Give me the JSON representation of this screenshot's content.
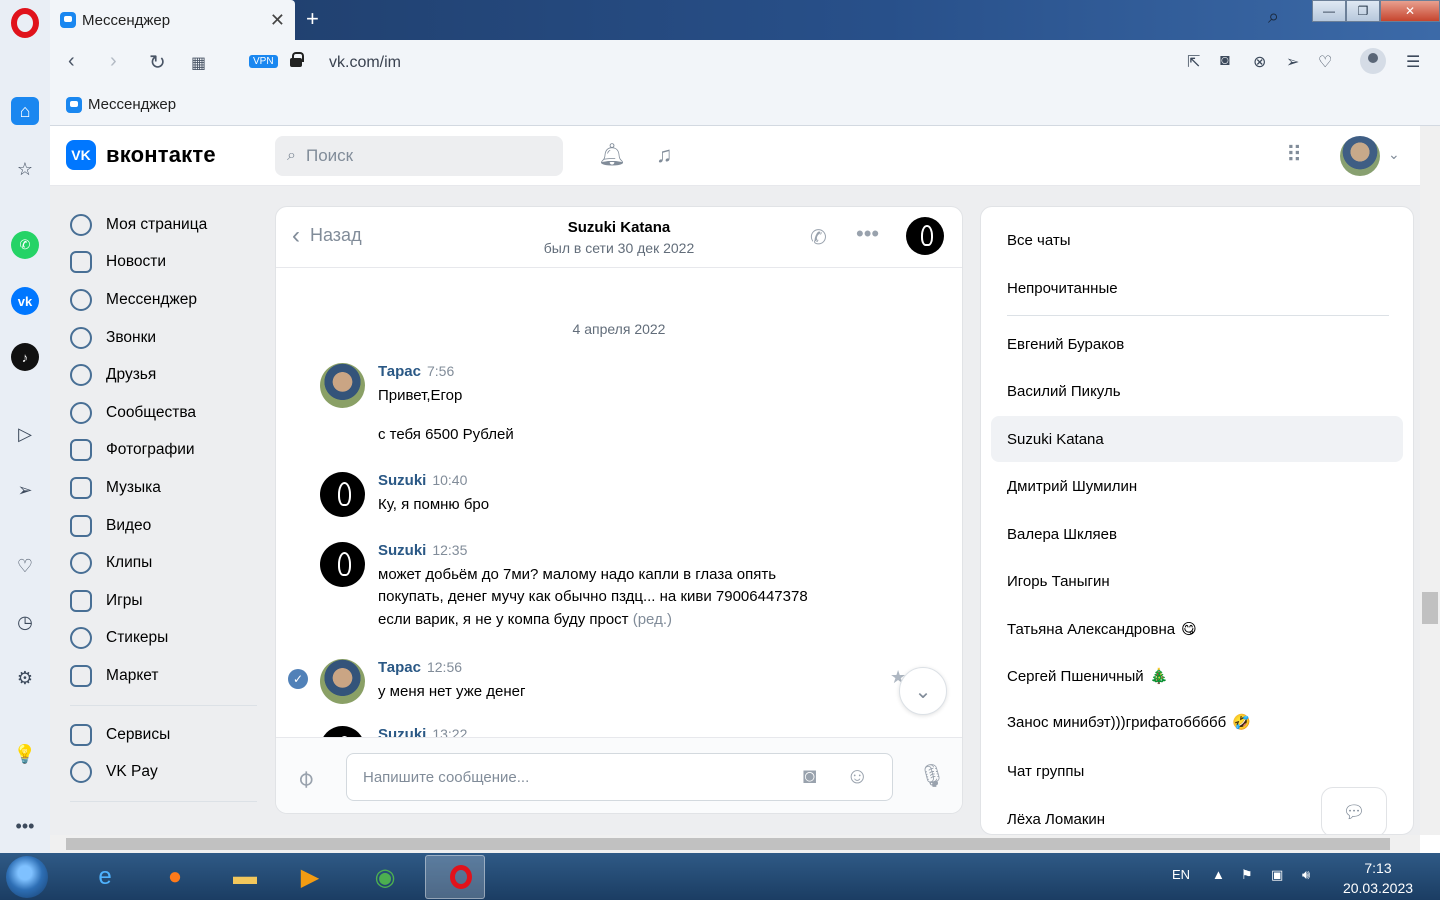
{
  "browser": {
    "tab_title": "Мессенджер",
    "tab_close": "✕",
    "new_tab": "+",
    "vpn": "VPN",
    "url": "vk.com/im",
    "bookmark": "Мессенджер"
  },
  "vk": {
    "logo_short": "VK",
    "logo_text": "вконтакте",
    "search_placeholder": "Поиск"
  },
  "nav": {
    "items": [
      "Моя страница",
      "Новости",
      "Мессенджер",
      "Звонки",
      "Друзья",
      "Сообщества",
      "Фотографии",
      "Музыка",
      "Видео",
      "Клипы",
      "Игры",
      "Стикеры",
      "Маркет"
    ],
    "items2": [
      "Сервисы",
      "VK Pay"
    ]
  },
  "chat": {
    "back": "Назад",
    "peer_name": "Suzuki Katana",
    "peer_status": "был в сети 30 дек 2022",
    "date": "4 апреля 2022",
    "messages": [
      {
        "author": "Тарас",
        "time": "7:56",
        "lines": [
          "Привет,Егор"
        ]
      },
      {
        "text": "с тебя 6500 Рублей"
      },
      {
        "author": "Suzuki",
        "time": "10:40",
        "lines": [
          "Ку, я помню бро"
        ]
      },
      {
        "author": "Suzuki",
        "time": "12:35",
        "lines": [
          "может добьём до 7ми? малому надо капли в глаза опять",
          "покупать, денег мучу как обычно пздц... на киви 79006447378",
          "если варик, я не у компа буду прост"
        ],
        "edited": "(ред.)"
      },
      {
        "author": "Тарас",
        "time": "12:56",
        "lines": [
          "у меня нет уже денег"
        ]
      },
      {
        "author": "Suzuki",
        "time": "13:22"
      }
    ],
    "composer_placeholder": "Напишите сообщение..."
  },
  "chat_list": {
    "filters": [
      "Все чаты",
      "Непрочитанные"
    ],
    "chats": [
      {
        "name": "Евгений Бураков"
      },
      {
        "name": "Василий Пикуль"
      },
      {
        "name": "Suzuki Katana",
        "active": true
      },
      {
        "name": "Дмитрий Шумилин"
      },
      {
        "name": "Валера Шкляев"
      },
      {
        "name": "Игорь Таныгин"
      },
      {
        "name": "Татьяна Александровна",
        "emoji": "😋"
      },
      {
        "name": "Сергей Пшеничный",
        "emoji": "🎄"
      },
      {
        "name": "Занос минибэт)))грифатоббббб",
        "emoji": "🤣"
      },
      {
        "name": "Чат группы"
      },
      {
        "name": "Лёха Ломакин"
      }
    ]
  },
  "taskbar": {
    "lang": "EN",
    "time": "7:13",
    "date": "20.03.2023"
  },
  "colors": {
    "vk_blue": "#0077ff",
    "author": "#2a5885",
    "opera_red": "#e0121b"
  }
}
